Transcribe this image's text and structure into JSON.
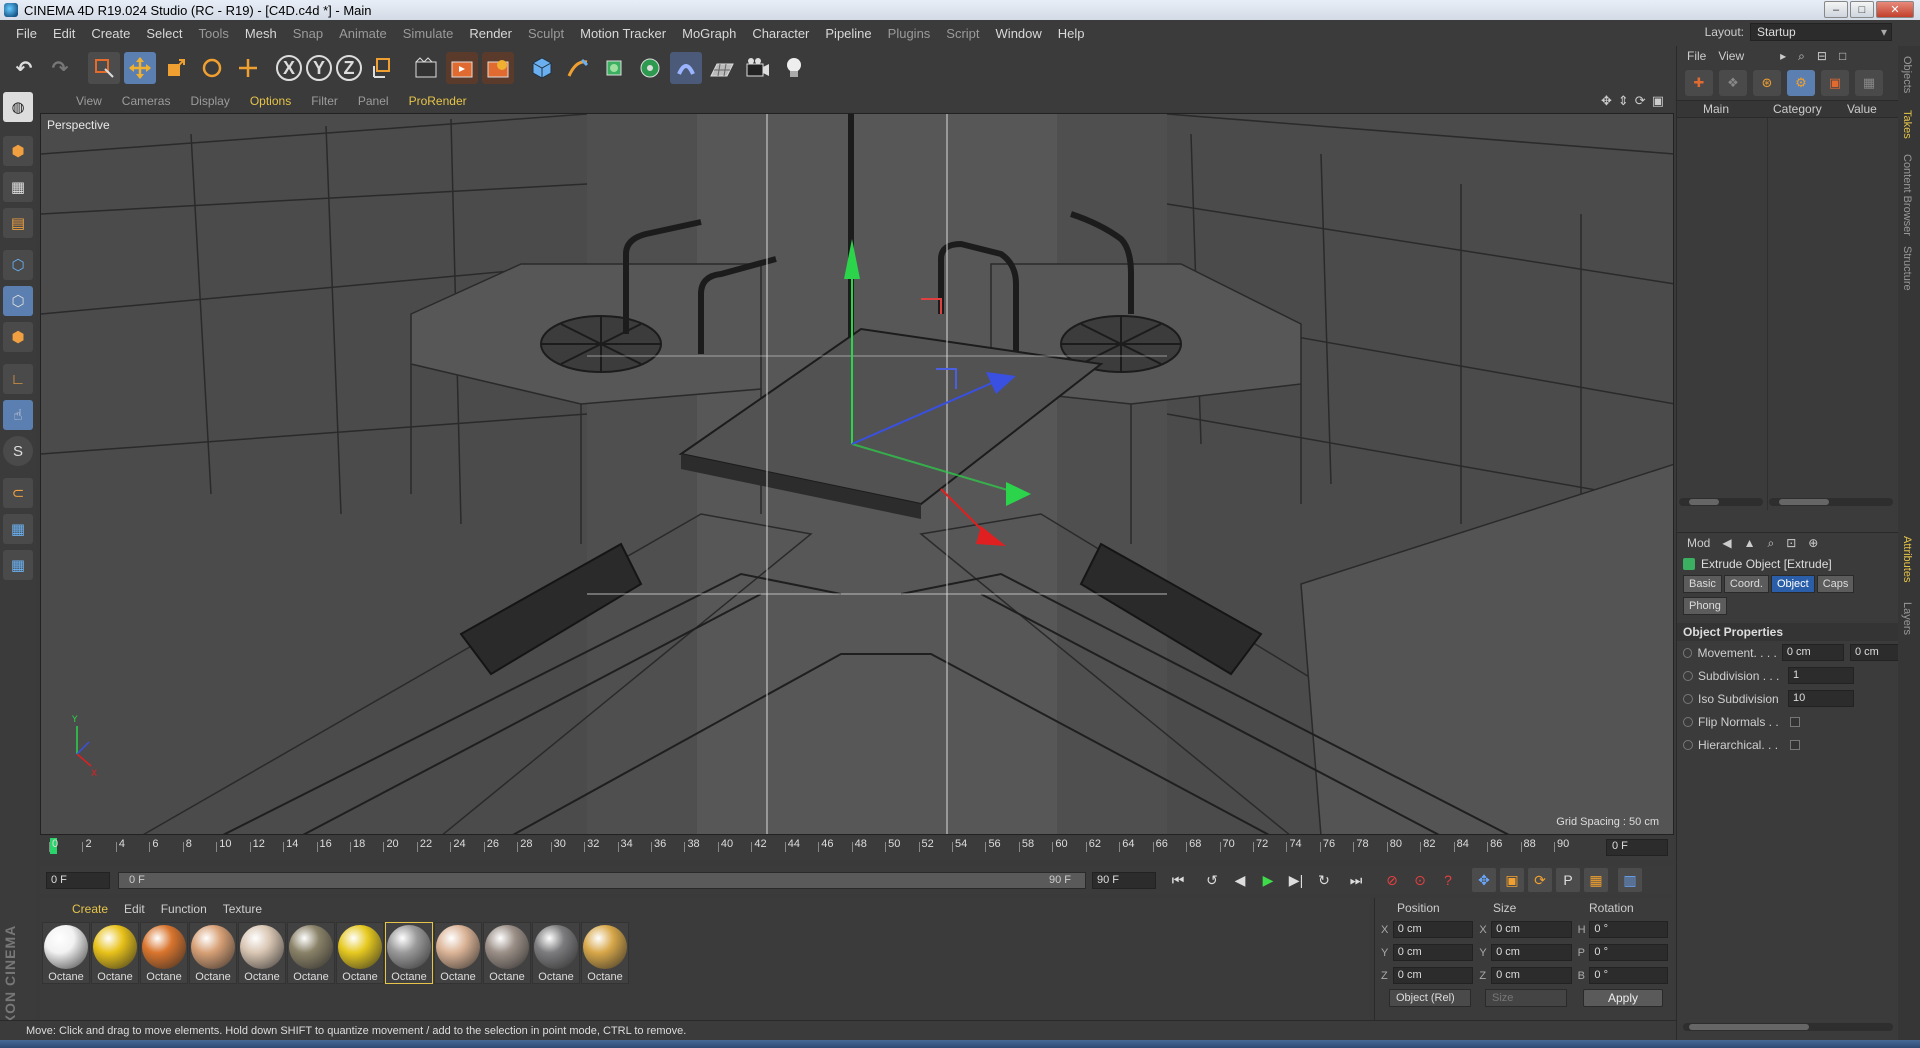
{
  "window": {
    "title": "CINEMA 4D R19.024 Studio (RC - R19) - [C4D.c4d *] - Main",
    "buttons": [
      "–",
      "□",
      "✕"
    ]
  },
  "menubar": {
    "items": [
      "File",
      "Edit",
      "Create",
      "Select",
      "Tools",
      "Mesh",
      "Snap",
      "Animate",
      "Simulate",
      "Render",
      "Sculpt",
      "Motion Tracker",
      "MoGraph",
      "Character",
      "Pipeline",
      "Plugins",
      "Script",
      "Window",
      "Help"
    ],
    "layout_label": "Layout:",
    "layout_value": "Startup"
  },
  "toolbar": {
    "axis_x": "X",
    "axis_y": "Y",
    "axis_z": "Z"
  },
  "viewport": {
    "menu": [
      "View",
      "Cameras",
      "Display",
      "Options",
      "Filter",
      "Panel",
      "ProRender"
    ],
    "label": "Perspective",
    "grid_spacing": "Grid Spacing : 50 cm"
  },
  "timeline": {
    "ticks": [
      "0",
      "2",
      "4",
      "6",
      "8",
      "10",
      "12",
      "14",
      "16",
      "18",
      "20",
      "22",
      "24",
      "26",
      "28",
      "30",
      "32",
      "34",
      "36",
      "38",
      "40",
      "42",
      "44",
      "46",
      "48",
      "50",
      "52",
      "54",
      "56",
      "58",
      "60",
      "62",
      "64",
      "66",
      "68",
      "70",
      "72",
      "74",
      "76",
      "78",
      "80",
      "82",
      "84",
      "86",
      "88",
      "90"
    ],
    "end_frame": "0 F",
    "current": "0 F",
    "range_start": "0 F",
    "range_end": "90 F",
    "max": "90 F"
  },
  "materials": {
    "menu": [
      "Create",
      "Edit",
      "Function",
      "Texture"
    ],
    "items": [
      {
        "name": "Octane",
        "color": "#f2f2f2"
      },
      {
        "name": "Octane",
        "color": "#e8c21a"
      },
      {
        "name": "Octane",
        "color": "#d9752e"
      },
      {
        "name": "Octane",
        "color": "#d7a076"
      },
      {
        "name": "Octane",
        "color": "#d9c6b3"
      },
      {
        "name": "Octane",
        "color": "#8a8268"
      },
      {
        "name": "Octane",
        "color": "#e6c920"
      },
      {
        "name": "Octane",
        "color": "#9a9a9a"
      },
      {
        "name": "Octane",
        "color": "#dbb497"
      },
      {
        "name": "Octane",
        "color": "#9c9088"
      },
      {
        "name": "Octane",
        "color": "#7c7c7e"
      },
      {
        "name": "Octane",
        "color": "#d8a84a"
      }
    ]
  },
  "coords": {
    "headers": [
      "Position",
      "Size",
      "Rotation"
    ],
    "rows": [
      {
        "ax": "X",
        "pos": "0 cm",
        "ax2": "X",
        "size": "0 cm",
        "ax3": "H",
        "rot": "0 °"
      },
      {
        "ax": "Y",
        "pos": "0 cm",
        "ax2": "Y",
        "size": "0 cm",
        "ax3": "P",
        "rot": "0 °"
      },
      {
        "ax": "Z",
        "pos": "0 cm",
        "ax2": "Z",
        "size": "0 cm",
        "ax3": "B",
        "rot": "0 °"
      }
    ],
    "mode": "Object (Rel)",
    "size_mode": "Size",
    "apply": "Apply"
  },
  "status": "Move: Click and drag to move elements. Hold down SHIFT to quantize movement / add to the selection in point mode, CTRL to remove.",
  "takes": {
    "menu": [
      "File",
      "View"
    ],
    "cols": [
      "Main",
      "Category",
      "Value"
    ]
  },
  "attributes": {
    "menu": "Mod",
    "object": "Extrude Object [Extrude]",
    "tabs": [
      "Basic",
      "Coord.",
      "Object",
      "Caps",
      "Phong"
    ],
    "active_tab": "Object",
    "section": "Object Properties",
    "props": [
      {
        "label": "Movement. . . .",
        "v1": "0 cm",
        "v2": "0 cm"
      },
      {
        "label": "Subdivision . . .",
        "v1": "1"
      },
      {
        "label": "Iso Subdivision",
        "v1": "10"
      },
      {
        "label": "Flip Normals . ."
      },
      {
        "label": "Hierarchical. . ."
      }
    ]
  },
  "side_tabs": [
    "Objects",
    "Takes",
    "Content Browser",
    "Structure",
    "Attributes",
    "Layers"
  ]
}
